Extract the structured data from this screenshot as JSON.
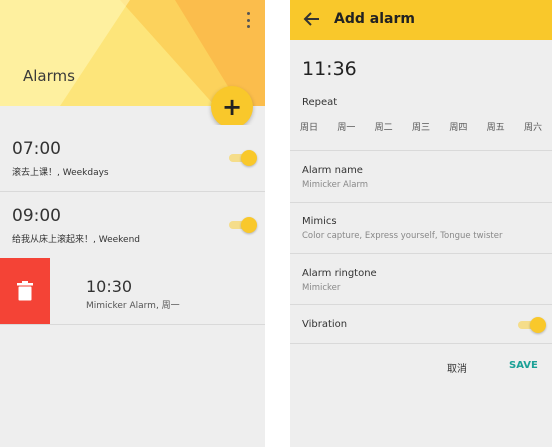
{
  "left": {
    "header": {
      "title": "Alarms"
    },
    "fab": {
      "label": "+"
    },
    "alarms": [
      {
        "time": "07:00",
        "subtitle": "滚去上课！, Weekdays",
        "enabled": true
      },
      {
        "time": "09:00",
        "subtitle": "给我从床上滚起来！, Weekend",
        "enabled": true
      }
    ],
    "swiped_alarm": {
      "time": "10:30",
      "subtitle": "Mimicker Alarm, 周一"
    }
  },
  "right": {
    "appbar": {
      "title": "Add alarm"
    },
    "time": "11:36",
    "repeat": {
      "label": "Repeat",
      "days": [
        "周日",
        "周一",
        "周二",
        "周三",
        "周四",
        "周五",
        "周六"
      ]
    },
    "alarm_name": {
      "title": "Alarm name",
      "value": "Mimicker Alarm"
    },
    "mimics": {
      "title": "Mimics",
      "value": "Color capture, Express yourself, Tongue twister"
    },
    "ringtone": {
      "title": "Alarm ringtone",
      "value": "Mimicker"
    },
    "vibration": {
      "title": "Vibration",
      "enabled": true
    },
    "actions": {
      "cancel": "取消",
      "save": "SAVE"
    }
  },
  "colors": {
    "accent": "#f9c82b",
    "delete": "#f44336",
    "save_text": "#1aa096",
    "background": "#eeeeee"
  }
}
